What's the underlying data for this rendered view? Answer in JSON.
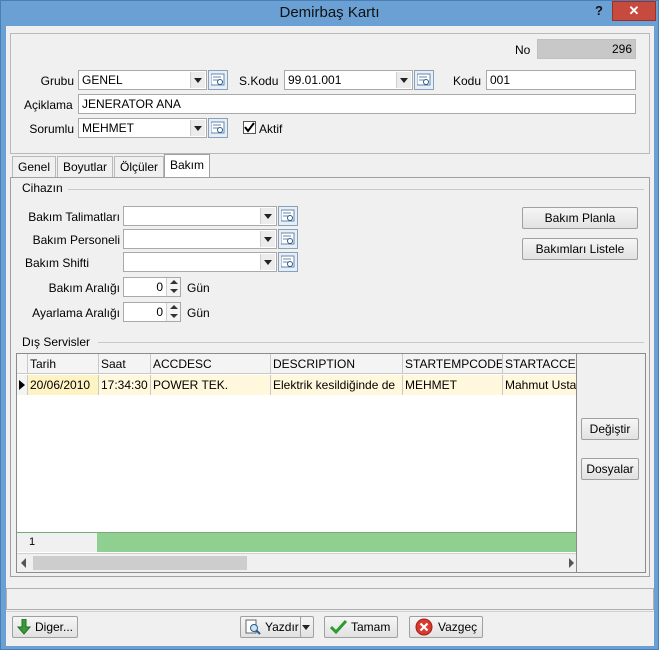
{
  "window": {
    "title": "Demirbaş Kartı",
    "help": "?",
    "close": "✕"
  },
  "header": {
    "no_label": "No",
    "no_value": "296",
    "grubu_label": "Grubu",
    "grubu_value": "GENEL",
    "skodu_label": "S.Kodu",
    "skodu_value": "99.01.001",
    "kodu_label": "Kodu",
    "kodu_value": "001",
    "aciklama_label": "Açiklama",
    "aciklama_value": "JENERATOR ANA",
    "sorumlu_label": "Sorumlu",
    "sorumlu_value": "MEHMET",
    "aktif_label": "Aktif",
    "aktif_checked": true
  },
  "tabs": [
    {
      "label": "Genel"
    },
    {
      "label": "Boyutlar"
    },
    {
      "label": "Ölçüler"
    },
    {
      "label": "Bakım",
      "active": true
    }
  ],
  "bakim": {
    "cihazin_label": "Cihazın",
    "talimat_label": "Bakım Talimatları",
    "talimat_value": "",
    "personel_label": "Bakım Personeli",
    "personel_value": "",
    "shift_label": "Bakım Shifti",
    "shift_value": "",
    "aralik_label": "Bakım Aralığı",
    "aralik_value": "0",
    "aralik_unit": "Gün",
    "ayarlama_label": "Ayarlama Aralığı",
    "ayarlama_value": "0",
    "ayarlama_unit": "Gün",
    "planla_button": "Bakım Planla",
    "listele_button": "Bakımları Listele",
    "dis_servisler_label": "Dış Servisler"
  },
  "grid": {
    "columns": [
      "Tarih",
      "Saat",
      "ACCDESC",
      "DESCRIPTION",
      "STARTEMPCODE",
      "STARTACCE"
    ],
    "rows": [
      [
        "20/06/2010",
        "17:34:30",
        "POWER TEK.",
        "Elektrik kesildiğinde de",
        "MEHMET",
        "Mahmut Usta"
      ]
    ],
    "footer_count": "1"
  },
  "side_buttons": {
    "degistir": "Değiştir",
    "dosyalar": "Dosyalar"
  },
  "bottom": {
    "diger": "Diger...",
    "yazdir": "Yazdır",
    "tamam": "Tamam",
    "vazgec": "Vazgeç"
  }
}
